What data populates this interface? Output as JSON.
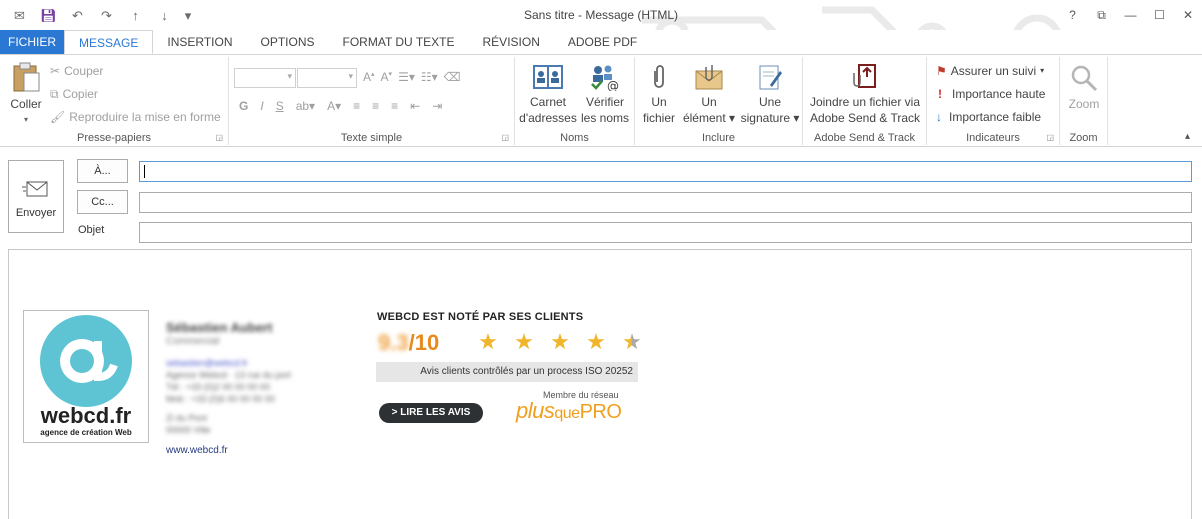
{
  "window": {
    "title": "Sans titre - Message (HTML)",
    "help": "?",
    "restore": "⧉",
    "minimize": "—",
    "maximize": "☐",
    "close": "✕"
  },
  "qat": {
    "icons": [
      "envelope-icon",
      "save-icon",
      "undo-icon",
      "redo-icon",
      "arrow-up-icon",
      "arrow-down-icon",
      "customize-icon"
    ]
  },
  "tabs": [
    "FICHIER",
    "MESSAGE",
    "INSERTION",
    "OPTIONS",
    "FORMAT DU TEXTE",
    "RÉVISION",
    "ADOBE PDF"
  ],
  "ribbon": {
    "clipboard": {
      "label": "Presse-papiers",
      "paste": "Coller",
      "cut": "Couper",
      "copy": "Copier",
      "format_painter": "Reproduire la mise en forme"
    },
    "basic_text": {
      "label": "Texte simple",
      "bold": "G",
      "italic": "I",
      "underline": "S"
    },
    "names": {
      "label": "Noms",
      "address_book_line1": "Carnet",
      "address_book_line2": "d'adresses",
      "check_names_line1": "Vérifier",
      "check_names_line2": "les noms"
    },
    "include": {
      "label": "Inclure",
      "attach_file_line1": "Un",
      "attach_file_line2": "fichier",
      "attach_item_line1": "Un",
      "attach_item_line2": "élément",
      "signature_line1": "Une",
      "signature_line2": "signature"
    },
    "adobe": {
      "label": "Adobe Send & Track",
      "attach_line1": "Joindre un fichier via",
      "attach_line2": "Adobe Send & Track"
    },
    "tags": {
      "label": "Indicateurs",
      "follow_up": "Assurer un suivi",
      "high": "Importance haute",
      "low": "Importance faible"
    },
    "zoom": {
      "label": "Zoom",
      "button": "Zoom"
    }
  },
  "header": {
    "send": "Envoyer",
    "to_button": "À...",
    "cc_button": "Cc...",
    "subject_label": "Objet",
    "to_value": "",
    "cc_value": "",
    "subject_value": ""
  },
  "signature": {
    "logo_text": "webcd.fr",
    "logo_tagline": "agence de création Web",
    "name": "Sébastien Aubert",
    "role": "Commercial",
    "email": "sebastien@webcd.fr",
    "line1": "Agence Webcd · 13 rue du port",
    "line2": "Tél : +33 (0)2 00 00 00 00",
    "line3": "Mob : +33 (0)6 00 00 00 00",
    "line4": "Zi du Pont",
    "line5": "00000 Ville",
    "url": "www.webcd.fr",
    "rating_title": "WEBCD EST NOTÉ PAR SES CLIENTS",
    "score": "9.3",
    "score_suffix": "/10",
    "rating_stars": 4.5,
    "avis_text": "Avis clients contrôlés par un process ISO 20252",
    "read_button": "> LIRE LES AVIS",
    "member_text": "Membre du réseau",
    "network_plus": "plus",
    "network_que": "que",
    "network_pro": "PRO"
  },
  "colors": {
    "accent": "#2b78d4",
    "brand_teal": "#5ec3d3",
    "rating_orange": "#e78a1d",
    "star": "#f0b52a",
    "flag_red": "#c0392b"
  }
}
